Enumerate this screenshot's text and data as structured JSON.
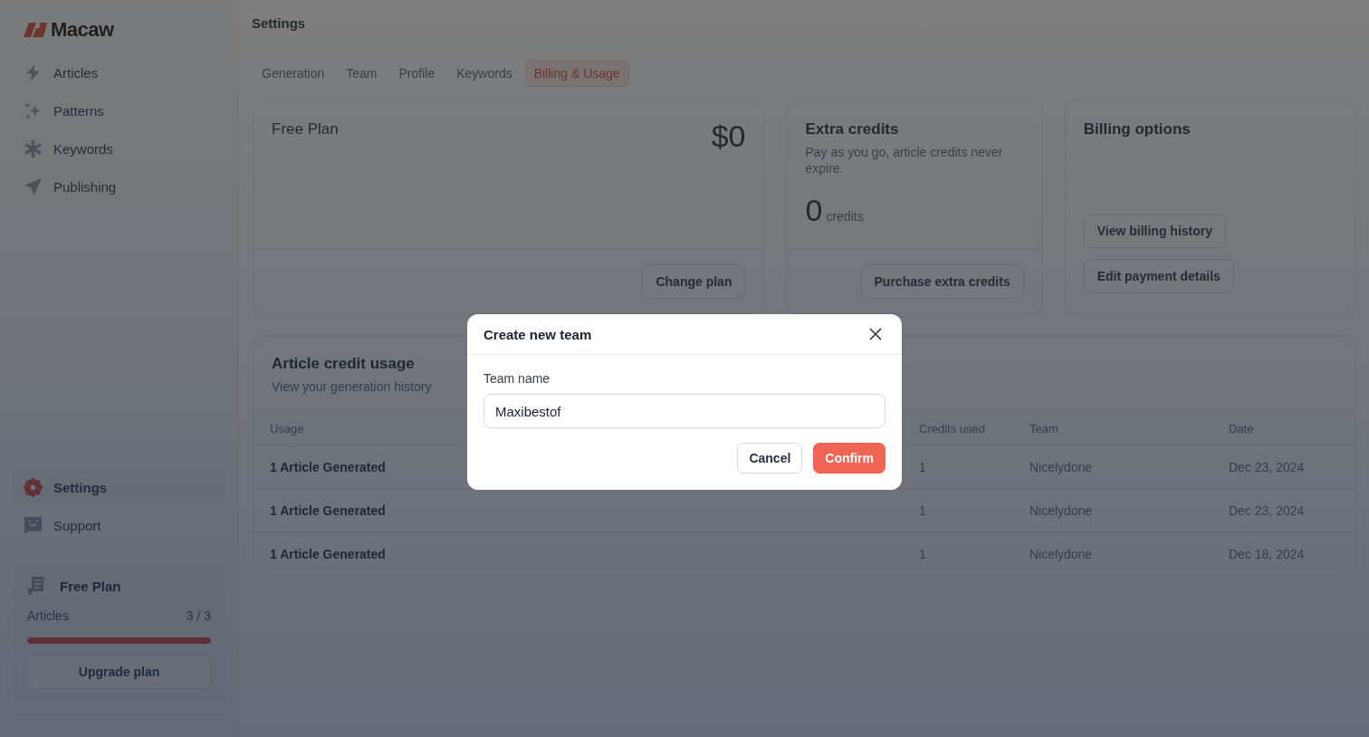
{
  "sidebar": {
    "logo": "Macaw",
    "nav": [
      {
        "label": "Articles",
        "selected": false
      },
      {
        "label": "Patterns",
        "selected": false
      },
      {
        "label": "Keywords",
        "selected": false
      },
      {
        "label": "Publishing",
        "selected": false
      }
    ],
    "bottom_nav": [
      {
        "label": "Settings",
        "selected": true
      },
      {
        "label": "Support",
        "selected": false
      }
    ],
    "plan_box": {
      "title": "Free Plan",
      "label": "Articles",
      "count": "3 / 3",
      "level": 1,
      "button": "Upgrade plan"
    }
  },
  "header": {
    "title": "Settings"
  },
  "tabs": [
    {
      "label": "Generation",
      "selected": false
    },
    {
      "label": "Team",
      "selected": false
    },
    {
      "label": "Profile",
      "selected": false
    },
    {
      "label": "Keywords",
      "selected": false
    },
    {
      "label": "Billing & Usage",
      "selected": true
    }
  ],
  "plan_card": {
    "title": "Free Plan",
    "price": "$0",
    "button": "Change plan"
  },
  "credits_card": {
    "title": "Extra credits",
    "description": "Pay as you go, article credits never expire.",
    "amount": "0",
    "unit": "credits",
    "button": "Purchase extra credits"
  },
  "billing_card": {
    "title": "Billing options",
    "buttons": [
      "View billing history",
      "Edit payment details"
    ]
  },
  "usage": {
    "title": "Article credit usage",
    "subtitle": "View your generation history",
    "columns": [
      "Usage",
      "Credits used",
      "Team",
      "Date"
    ],
    "rows": [
      [
        "1 Article Generated",
        "1",
        "Nicelydone",
        "Dec 23, 2024"
      ],
      [
        "1 Article Generated",
        "1",
        "Nicelydone",
        "Dec 23, 2024"
      ],
      [
        "1 Article Generated",
        "1",
        "Nicelydone",
        "Dec 18, 2024"
      ]
    ]
  },
  "modal": {
    "title": "Create new team",
    "field_label": "Team name",
    "value": "Maxibestof",
    "buttons": [
      {
        "label": "Cancel",
        "kind": "secondary"
      },
      {
        "label": "Confirm",
        "kind": "primary"
      }
    ]
  }
}
